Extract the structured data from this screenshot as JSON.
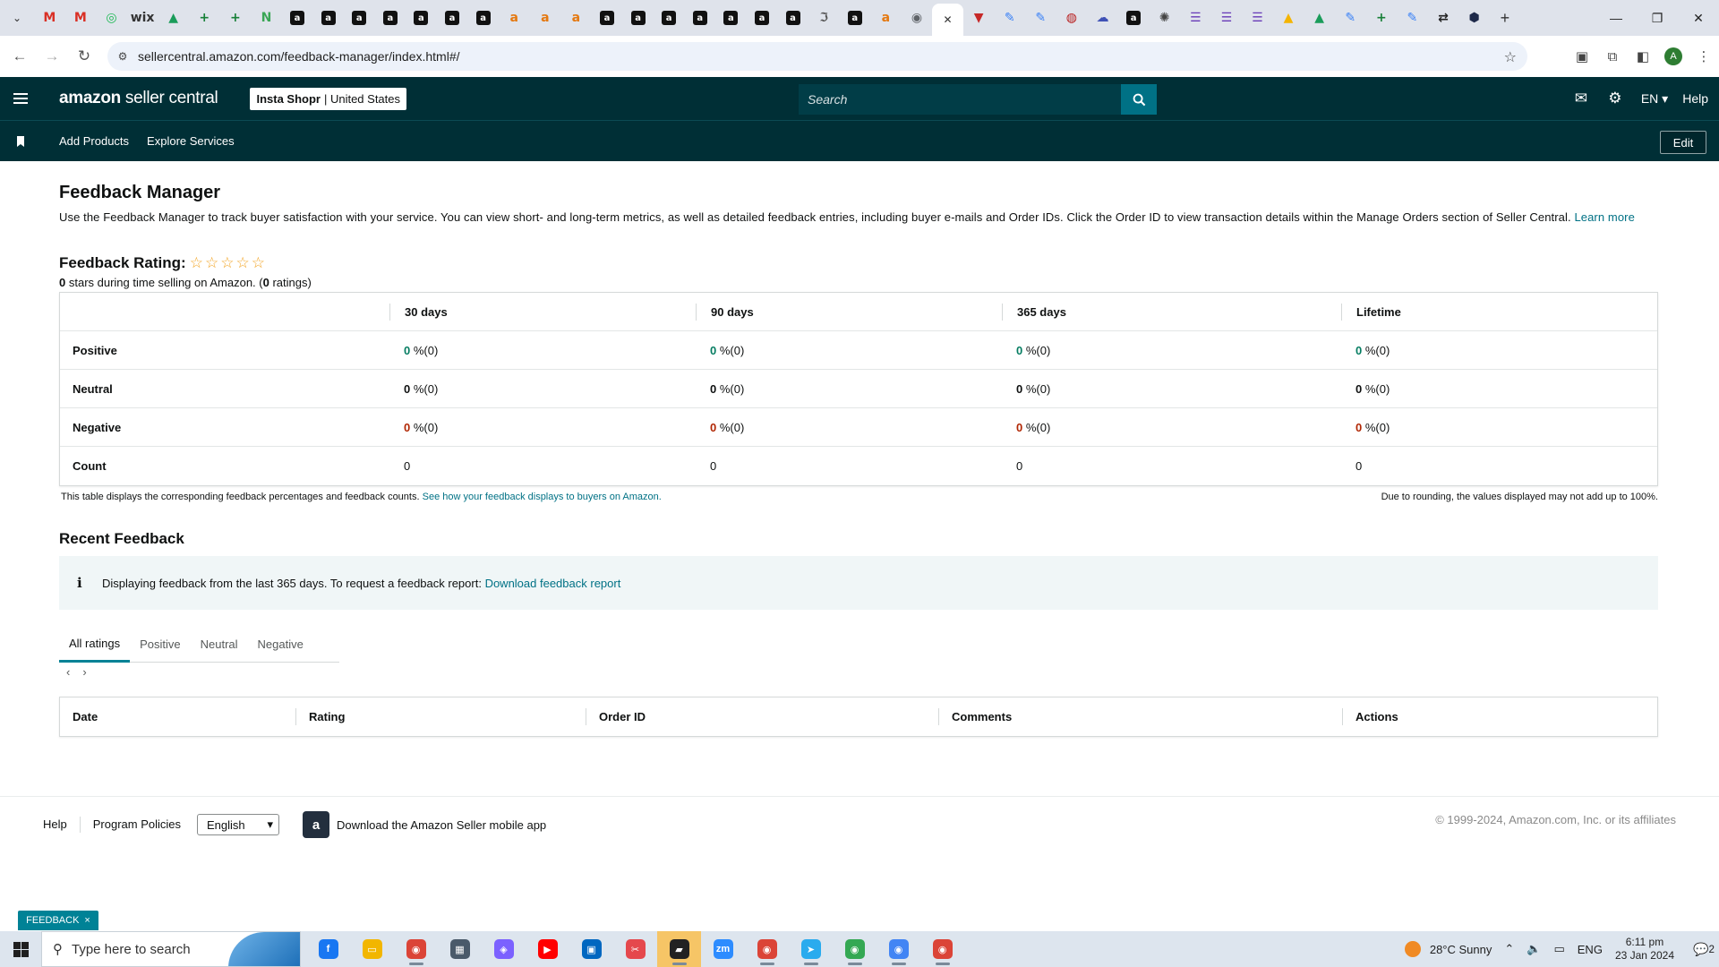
{
  "browser": {
    "tab_favicons": [
      {
        "name": "gmail-favicon",
        "glyph": "M",
        "color": "#d93025"
      },
      {
        "name": "gmail-favicon",
        "glyph": "M",
        "color": "#d93025"
      },
      {
        "name": "spotify-favicon",
        "glyph": "◎",
        "color": "#1db954"
      },
      {
        "name": "wix-favicon",
        "glyph": "wix",
        "color": "#333333"
      },
      {
        "name": "drive-favicon",
        "glyph": "▲",
        "color": "#1a9c5a"
      },
      {
        "name": "sheets-favicon",
        "glyph": "+",
        "color": "#188038"
      },
      {
        "name": "sheets-favicon",
        "glyph": "+",
        "color": "#188038"
      },
      {
        "name": "feather-favicon",
        "glyph": "N",
        "color": "#3aa655"
      },
      {
        "name": "amazon-favicon",
        "glyph": "a",
        "color": "#111111"
      },
      {
        "name": "amazon-favicon",
        "glyph": "a",
        "color": "#111111"
      },
      {
        "name": "amazon-favicon",
        "glyph": "a",
        "color": "#111111"
      },
      {
        "name": "amazon-favicon",
        "glyph": "a",
        "color": "#111111"
      },
      {
        "name": "amazon-favicon",
        "glyph": "a",
        "color": "#111111"
      },
      {
        "name": "amazon-favicon",
        "glyph": "a",
        "color": "#111111"
      },
      {
        "name": "amazon-favicon",
        "glyph": "a",
        "color": "#111111"
      },
      {
        "name": "amazon-smile-favicon",
        "glyph": "a",
        "color": "#e47911"
      },
      {
        "name": "amazon-smile-favicon",
        "glyph": "a",
        "color": "#e47911"
      },
      {
        "name": "amazon-smile-favicon",
        "glyph": "a",
        "color": "#e47911"
      },
      {
        "name": "amazon-favicon",
        "glyph": "a",
        "color": "#111111"
      },
      {
        "name": "amazon-favicon",
        "glyph": "a",
        "color": "#111111"
      },
      {
        "name": "amazon-favicon",
        "glyph": "a",
        "color": "#111111"
      },
      {
        "name": "amazon-favicon",
        "glyph": "a",
        "color": "#111111"
      },
      {
        "name": "amazon-favicon",
        "glyph": "a",
        "color": "#111111"
      },
      {
        "name": "amazon-favicon",
        "glyph": "a",
        "color": "#111111"
      },
      {
        "name": "amazon-favicon",
        "glyph": "a",
        "color": "#111111"
      },
      {
        "name": "script-favicon",
        "glyph": "ℑ",
        "color": "#555555"
      },
      {
        "name": "amazon-favicon",
        "glyph": "a",
        "color": "#111111"
      },
      {
        "name": "amazon-smile-favicon",
        "glyph": "a",
        "color": "#e47911"
      },
      {
        "name": "globe-favicon",
        "glyph": "◉",
        "color": "#5f6368"
      },
      {
        "name": "close-tab-icon",
        "glyph": "✕",
        "color": "#ffffff",
        "active": true
      },
      {
        "name": "brand-favicon",
        "glyph": "▼",
        "color": "#c62828"
      },
      {
        "name": "pencil-favicon",
        "glyph": "✎",
        "color": "#3b82f6"
      },
      {
        "name": "pencil-favicon",
        "glyph": "✎",
        "color": "#3b82f6"
      },
      {
        "name": "oval-favicon",
        "glyph": "◍",
        "color": "#b71c1c"
      },
      {
        "name": "cloud-favicon",
        "glyph": "☁",
        "color": "#3f51b5"
      },
      {
        "name": "amazon-favicon",
        "glyph": "a",
        "color": "#111111"
      },
      {
        "name": "openai-favicon",
        "glyph": "✺",
        "color": "#444444"
      },
      {
        "name": "forms-favicon",
        "glyph": "☰",
        "color": "#673ab7"
      },
      {
        "name": "forms-favicon",
        "glyph": "☰",
        "color": "#673ab7"
      },
      {
        "name": "forms-favicon",
        "glyph": "☰",
        "color": "#673ab7"
      },
      {
        "name": "drive-favicon",
        "glyph": "▲",
        "color": "#f4b400"
      },
      {
        "name": "drive-favicon",
        "glyph": "▲",
        "color": "#1a9c5a"
      },
      {
        "name": "pencil-favicon",
        "glyph": "✎",
        "color": "#3b82f6"
      },
      {
        "name": "sheets-favicon",
        "glyph": "+",
        "color": "#188038"
      },
      {
        "name": "pencil-favicon",
        "glyph": "✎",
        "color": "#3b82f6"
      },
      {
        "name": "shuffle-favicon",
        "glyph": "⇄",
        "color": "#222222"
      },
      {
        "name": "hex-favicon",
        "glyph": "⬢",
        "color": "#1e2a4a"
      }
    ],
    "url": "sellercentral.amazon.com/feedback-manager/index.html#/",
    "profile_initial": "A",
    "window_controls": [
      "—",
      "❐",
      "✕"
    ]
  },
  "header": {
    "logo_brand": "amazon",
    "logo_suffix": " seller central",
    "store_name": "Insta Shopr",
    "store_region": "| United States",
    "search_placeholder": "Search",
    "language": "EN",
    "help": "Help"
  },
  "subnav": {
    "links": [
      "Add Products",
      "Explore Services"
    ],
    "edit": "Edit"
  },
  "page": {
    "title": "Feedback Manager",
    "intro": "Use the Feedback Manager to track buyer satisfaction with your service. You can view short- and long-term metrics, as well as detailed feedback entries, including buyer e-mails and Order IDs. Click the Order ID to view transaction details within the Manage Orders section of Seller Central.",
    "learn_more": "Learn more",
    "rating_label": "Feedback Rating:",
    "stars": [
      "☆",
      "☆",
      "☆",
      "☆",
      "☆"
    ],
    "rating_stars_value": "0",
    "rating_sub_text": " stars during time selling on Amazon. (",
    "rating_count": "0",
    "rating_sub_end": " ratings)"
  },
  "metrics": {
    "columns": [
      "",
      "30 days",
      "90 days",
      "365 days",
      "Lifetime"
    ],
    "rows": [
      {
        "label": "Positive",
        "values": [
          "0",
          "0",
          "0",
          "0"
        ],
        "suffix": " %(0)",
        "tone": "green"
      },
      {
        "label": "Neutral",
        "values": [
          "0",
          "0",
          "0",
          "0"
        ],
        "suffix": " %(0)",
        "tone": "plain"
      },
      {
        "label": "Negative",
        "values": [
          "0",
          "0",
          "0",
          "0"
        ],
        "suffix": " %(0)",
        "tone": "red"
      },
      {
        "label": "Count",
        "values": [
          "0",
          "0",
          "0",
          "0"
        ],
        "suffix": "",
        "tone": "none"
      }
    ],
    "note": "This table displays the corresponding feedback percentages and feedback counts.",
    "note_link": "See how your feedback displays to buyers on Amazon.",
    "rounding_note": "Due to rounding, the values displayed may not add up to 100%."
  },
  "recent": {
    "title": "Recent Feedback",
    "info_icon": "i",
    "info_text": "Displaying feedback from the last 365 days. To request a feedback report: ",
    "info_link": "Download feedback report",
    "tabs": [
      "All ratings",
      "Positive",
      "Neutral",
      "Negative"
    ],
    "active_tab": 0,
    "prev": "‹",
    "next": "›",
    "table_columns": [
      "Date",
      "Rating",
      "Order ID",
      "Comments",
      "Actions"
    ]
  },
  "footer": {
    "links": [
      "Help",
      "Program Policies"
    ],
    "language_select": "English",
    "app_text": "Download the Amazon Seller mobile app",
    "copyright": "© 1999-2024, Amazon.com, Inc. or its affiliates",
    "feedback_tab": "FEEDBACK",
    "feedback_close": "×"
  },
  "taskbar": {
    "search_placeholder": "Type here to search",
    "apps": [
      {
        "name": "facebook-app",
        "glyph": "f",
        "color": "#1877f2",
        "run": false
      },
      {
        "name": "file-explorer-app",
        "glyph": "▭",
        "color": "#f2b600",
        "run": false
      },
      {
        "name": "chrome-app",
        "glyph": "◉",
        "color": "#db4437",
        "run": true
      },
      {
        "name": "calculator-app",
        "glyph": "▦",
        "color": "#4a5a6a",
        "run": false
      },
      {
        "name": "copilot-app",
        "glyph": "◈",
        "color": "#7b61ff",
        "run": false
      },
      {
        "name": "youtube-app",
        "glyph": "▶",
        "color": "#ff0000",
        "run": false
      },
      {
        "name": "store-app",
        "glyph": "▣",
        "color": "#0067c0",
        "run": false
      },
      {
        "name": "snipping-app",
        "glyph": "✂",
        "color": "#e5484d",
        "run": false
      },
      {
        "name": "sticky-notes-app",
        "glyph": "▰",
        "color": "#222222",
        "run": true,
        "highlight": true
      },
      {
        "name": "zoom-app",
        "glyph": "zm",
        "color": "#2d8cff",
        "run": false
      },
      {
        "name": "chrome-app",
        "glyph": "◉",
        "color": "#db4437",
        "run": true
      },
      {
        "name": "telegram-app",
        "glyph": "➤",
        "color": "#2aabee",
        "run": true
      },
      {
        "name": "chrome-app",
        "glyph": "◉",
        "color": "#34a853",
        "run": true
      },
      {
        "name": "chrome-app",
        "glyph": "◉",
        "color": "#4285f4",
        "run": true
      },
      {
        "name": "chrome-app",
        "glyph": "◉",
        "color": "#db4437",
        "run": true
      }
    ],
    "weather": "28°C  Sunny",
    "lang": "ENG",
    "time": "6:11 pm",
    "date": "23 Jan 2024",
    "notifications": "2"
  }
}
